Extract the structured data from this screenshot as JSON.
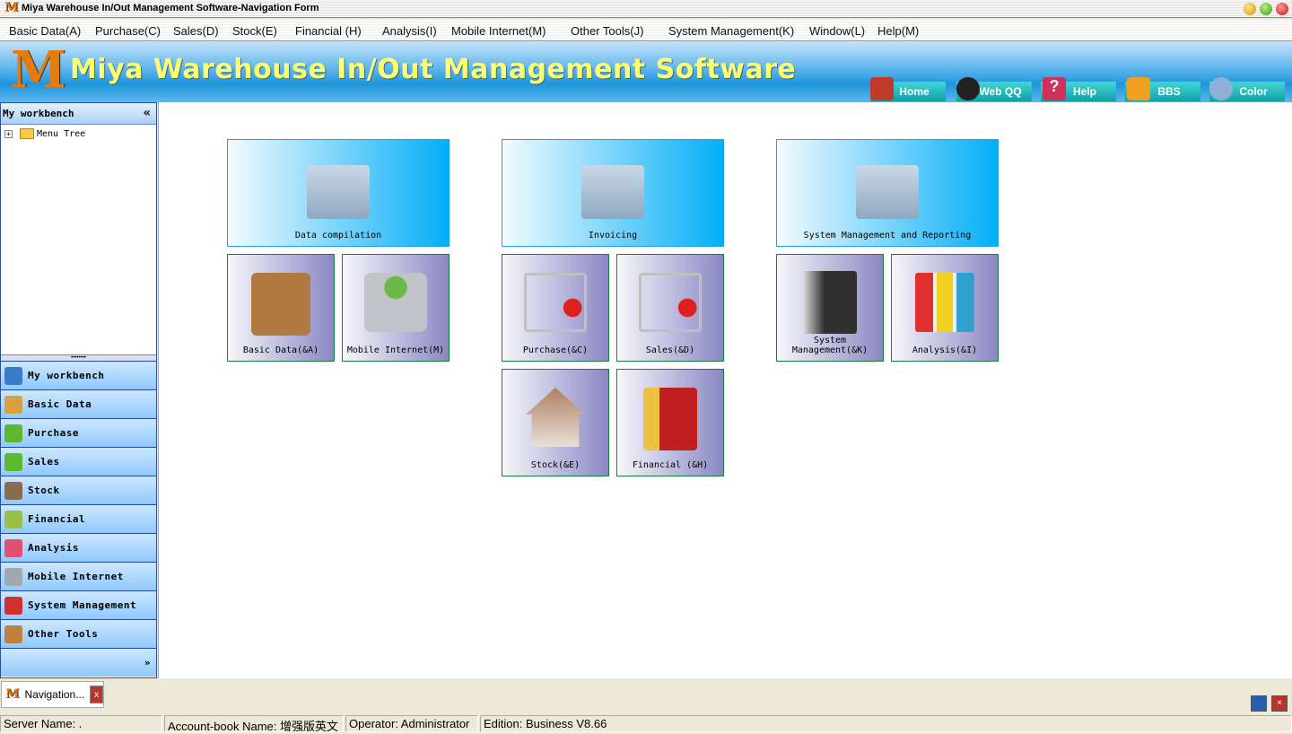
{
  "window": {
    "title": "Miya Warehouse In/Out Management Software-Navigation Form"
  },
  "menu": [
    "Basic Data(A)",
    "Purchase(C)",
    "Sales(D)",
    "Stock(E)",
    "Financial (H)",
    "Analysis(I)",
    "Mobile Internet(M)",
    "Other Tools(J)",
    "System Management(K)",
    "Window(L)",
    "Help(M)"
  ],
  "banner": {
    "title": "Miya Warehouse In/Out Management Software",
    "buttons": [
      {
        "label": "Home",
        "icon": "home-icon",
        "color": "#c0392b"
      },
      {
        "label": "Web QQ",
        "icon": "penguin-icon",
        "color": "#222222"
      },
      {
        "label": "Help",
        "icon": "question-icon",
        "color": "#d0305a"
      },
      {
        "label": "BBS",
        "icon": "people-icon",
        "color": "#f0a020"
      },
      {
        "label": "Color",
        "icon": "palette-icon",
        "color": "#8fb0d8"
      }
    ]
  },
  "sidebar": {
    "header": "My workbench",
    "collapse": "«",
    "tree_root": "Menu Tree",
    "expand": "»",
    "items": [
      {
        "label": "My workbench",
        "color": "#3a7bc8"
      },
      {
        "label": "Basic Data",
        "color": "#d8a040"
      },
      {
        "label": "Purchase",
        "color": "#5cb82e"
      },
      {
        "label": "Sales",
        "color": "#5cb82e"
      },
      {
        "label": "Stock",
        "color": "#8a6a50"
      },
      {
        "label": "Financial",
        "color": "#9bc04a"
      },
      {
        "label": "Analysis",
        "color": "#e05070"
      },
      {
        "label": "Mobile Internet",
        "color": "#a0a8b0"
      },
      {
        "label": "System Management",
        "color": "#d03030"
      },
      {
        "label": "Other Tools",
        "color": "#c08040"
      }
    ]
  },
  "tiles": {
    "groups": [
      "Data compilation",
      "Invoicing",
      "System Management and Reporting"
    ],
    "items": [
      {
        "label": "Basic Data(&A)",
        "color": "#b07a40"
      },
      {
        "label": "Mobile Internet(M)",
        "color": "#6cb848"
      },
      {
        "label": "Purchase(&C)",
        "color": "#e02020"
      },
      {
        "label": "Sales(&D)",
        "color": "#e02020"
      },
      {
        "label": "Stock(&E)",
        "color": "#b08060"
      },
      {
        "label": "Financial (&H)",
        "color": "#c02020"
      },
      {
        "label": "System Management(&K)",
        "color": "#303030"
      },
      {
        "label": "Analysis(&I)",
        "color": "#e03030"
      }
    ]
  },
  "taskbar": {
    "tab": "Navigation...",
    "close": "x"
  },
  "status": [
    "Server Name: .",
    "Account-book Name: 增强版英文",
    "Operator: Administrator",
    "Edition:  Business V8.66"
  ]
}
